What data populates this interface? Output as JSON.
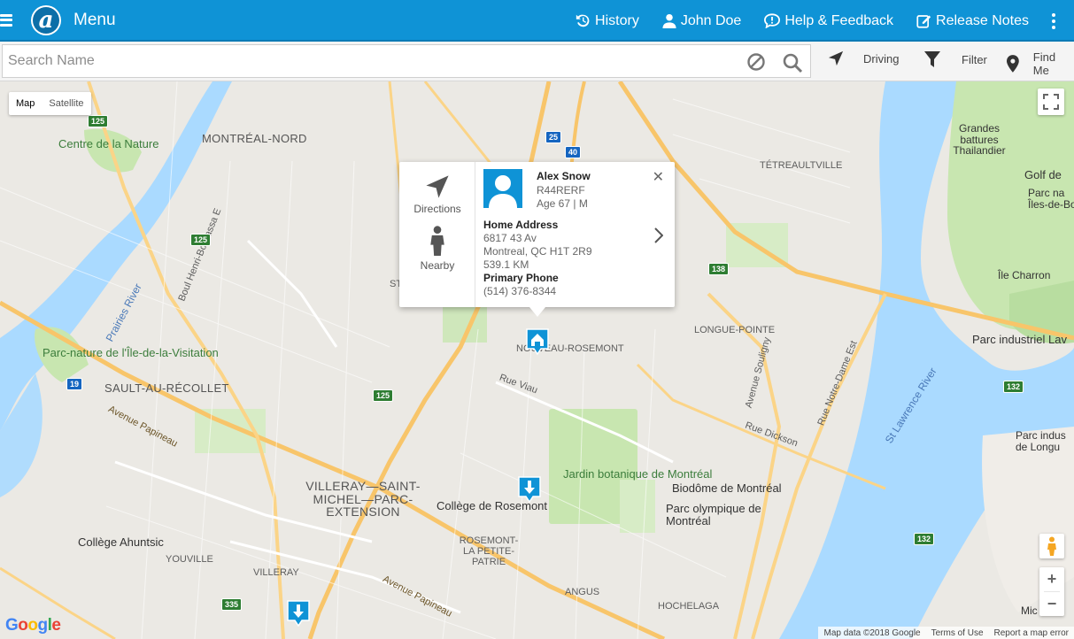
{
  "colors": {
    "brand": "#0f93d6",
    "water": "#aadaff",
    "park": "#c8e6b0",
    "highway": "#f8c56a"
  },
  "header": {
    "menu_label": "Menu",
    "logo_letter": "a",
    "items": [
      {
        "label": "History",
        "icon": "history-icon"
      },
      {
        "label": "John Doe",
        "icon": "user-icon"
      },
      {
        "label": "Help & Feedback",
        "icon": "feedback-icon"
      },
      {
        "label": "Release Notes",
        "icon": "edit-icon"
      }
    ]
  },
  "search": {
    "placeholder": "Search Name",
    "value": ""
  },
  "tools": {
    "driving": "Driving",
    "filter": "Filter",
    "find_me": "Find Me"
  },
  "map": {
    "type_buttons": [
      "Map",
      "Satellite"
    ],
    "active_type": "Map",
    "labels": {
      "montreal_nord": "MONTRÉAL-NORD",
      "centre_nature": "Centre de la Nature",
      "parc_nature": "Parc-nature de l'Île-de-la-Visitation",
      "sault": "SAULT-AU-RÉCOLLET",
      "villeray": "VILLERAY—SAINT-MICHEL—PARC-EXTENSION",
      "rosemont": "ROSEMONT-LA PETITE-PATRIE",
      "nouveau_rosemont": "NOUVEAU-ROSEMONT",
      "college_rosemont": "Collège de Rosemont",
      "college_ahuntsic": "Collège Ahuntsic",
      "youville": "YOUVILLE",
      "villeray_small": "VILLERAY",
      "angus": "ANGUS",
      "hochelaga": "HOCHELAGA",
      "jardin": "Jardin botanique de Montréal",
      "biodome": "Biodôme de Montréal",
      "parc_olympique": "Parc olympique de Montréal",
      "longue_pointe": "LONGUE-POINTE",
      "tetreaultville": "TÉTREAULTVILLE",
      "grandes_battures": "Grandes battures Thailandier",
      "golf": "Golf de",
      "parc_iles": "Parc na Îles-de-Bo",
      "ile_charron": "Île Charron",
      "parc_industriel": "Parc industriel Lav",
      "parc_indus_longue": "Parc indus de Longu",
      "mic": "Mic",
      "prairies_river": "Prairies River",
      "st_lawrence": "St Lawrence River",
      "papineau": "Avenue Papineau",
      "rue_dickson": "Rue Dickson",
      "rue_viau": "Rue Viau",
      "boul_henri": "Boul Henri-Bourassa E",
      "notre_dame": "Rue Notre-Dame Est",
      "ave_souligny": "Avenue Souligny",
      "ste": "STE"
    },
    "shields": [
      "125",
      "25",
      "40",
      "125",
      "19",
      "125",
      "138",
      "335",
      "132",
      "132"
    ],
    "attribution": "Map data ©2018 Google",
    "terms": "Terms of Use",
    "report": "Report a map error",
    "google": "Google"
  },
  "popup": {
    "directions": "Directions",
    "nearby": "Nearby",
    "name": "Alex Snow",
    "id": "R44RERF",
    "age": "Age 67 | M",
    "address_heading": "Home Address",
    "address_line1": "6817 43 Av",
    "address_line2": "Montreal, QC H1T 2R9",
    "distance": "539.1 KM",
    "phone_heading": "Primary Phone",
    "phone": "(514) 376-8344"
  }
}
